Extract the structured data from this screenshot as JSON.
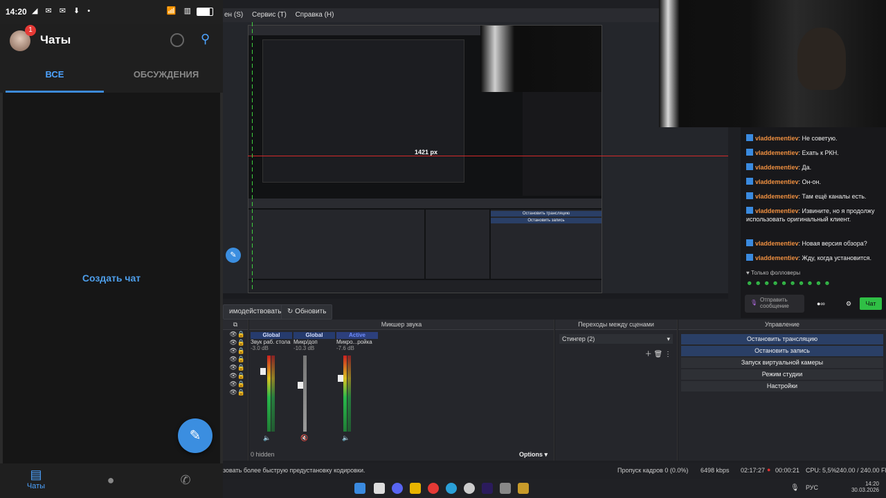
{
  "phone": {
    "status_time": "14:20",
    "header_title": "Чаты",
    "badge": "1",
    "tabs": [
      "ВСЕ",
      "ОБСУЖДЕНИЯ"
    ],
    "create_chat": "Создать чат",
    "nav": [
      {
        "label": "Чаты",
        "icon": "chat-icon"
      },
      {
        "label": "",
        "icon": "person-icon"
      },
      {
        "label": "",
        "icon": "phone-icon"
      }
    ]
  },
  "obs": {
    "menu": [
      "ен (S)",
      "Сервис (T)",
      "Справка (H)"
    ],
    "toolbar": {
      "studio_label": "имодействовать",
      "refresh_label": "Обновить"
    },
    "docks": {
      "mixer_title": "Микшер звука",
      "transitions_title": "Переходы между сценами",
      "controls_title": "Управление"
    },
    "mixer": {
      "channels": [
        {
          "tag": "Global",
          "name": "Звук раб. стола",
          "db": "-3.0 dB"
        },
        {
          "tag": "Global",
          "name": "Микр/доп",
          "db": "-10.3 dB"
        },
        {
          "tag": "Active",
          "name": "Микро...ройка",
          "db": "-7.6 dB"
        }
      ],
      "scale": [
        "0",
        "-6",
        "-12",
        "-18",
        "-24",
        "-30",
        "-36",
        "-42",
        "-48",
        "-54",
        "-60"
      ],
      "hidden_label": "0 hidden",
      "options_label": "Options"
    },
    "transitions": {
      "selected": "Стингер (2)"
    },
    "controls": [
      "Остановить трансляцию",
      "Остановить запись",
      "Запуск виртуальной камеры",
      "Режим студии",
      "Настройки"
    ],
    "status": {
      "encoding_hint": "зовать более быструю предустановку кодировки.",
      "dropped": "Пропуск кадров 0 (0.0%)",
      "bitrate": "6498 kbps",
      "stream_time": "02:17:27",
      "rec_time": "00:00:21",
      "cpu": "CPU: 5,5%",
      "fps": "240.00 / 240.00 FPS"
    },
    "preview_px": "1421 px",
    "chat": {
      "user": "vladdementiev",
      "messages": [
        "Не советую.",
        "Ехать к РКН.",
        "Да.",
        "Он-он.",
        "Там ещё каналы есть.",
        "Извините, но я продолжу использовать оригинальный клиент.",
        "Новая версия обзора?",
        "Жду, когда установится."
      ],
      "followers": "Только фолловеры",
      "send_placeholder": "Отправить сообщение",
      "chat_button": "Чат"
    },
    "taskbar": {
      "lang": "РУС",
      "time": "14:20",
      "date": "30.03.2026"
    }
  }
}
